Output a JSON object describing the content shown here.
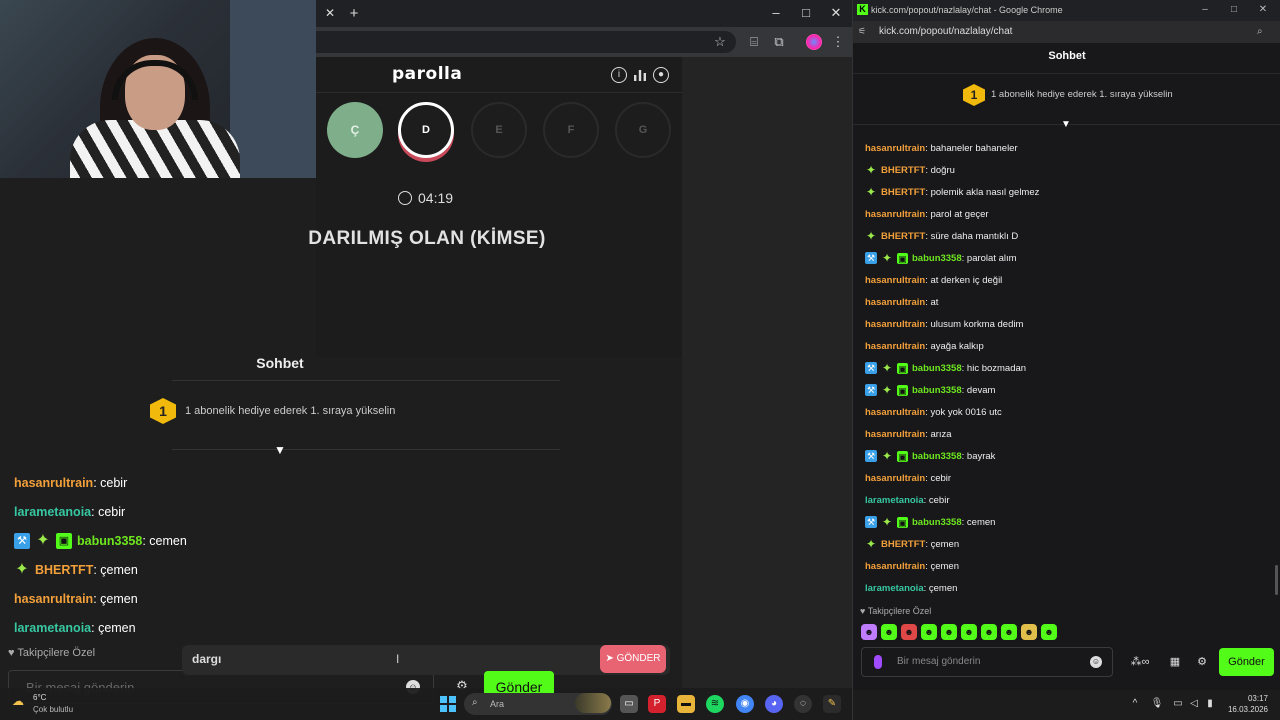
{
  "browser": {
    "window_controls": {
      "minimize": "–",
      "maximize": "□",
      "close": "✕"
    },
    "tab_close": "✕",
    "new_tab": "+"
  },
  "game": {
    "title": "parolla",
    "letters": [
      {
        "char": "Ç",
        "state": "done"
      },
      {
        "char": "D",
        "state": "active"
      },
      {
        "char": "E",
        "state": "idle"
      },
      {
        "char": "F",
        "state": "idle"
      },
      {
        "char": "G",
        "state": "idle"
      }
    ],
    "timer": "04:19",
    "clue": "DARILMIŞ OLAN (KİMSE)",
    "input_value": "dargı",
    "send_label": "GÖNDER"
  },
  "overlay_chat": {
    "title": "Sohbet",
    "gift_badge": "1",
    "gift_text": "1 abonelik hediye ederek 1. sıraya yükselin",
    "messages": [
      {
        "user": "hasanrultrain",
        "color": "#f2a03a",
        "text": ": cebir",
        "badges": []
      },
      {
        "user": "larametanoia",
        "color": "#37c7a1",
        "text": ": cebir",
        "badges": []
      },
      {
        "user": "babun3358",
        "color": "#6ee61f",
        "text": ": cemen",
        "badges": [
          "blue",
          "star",
          "gift"
        ]
      },
      {
        "user": "BHERTFT",
        "color": "#f2a03a",
        "text": ": çemen",
        "badges": [
          "star"
        ]
      },
      {
        "user": "hasanrultrain",
        "color": "#f2a03a",
        "text": ": çemen",
        "badges": []
      },
      {
        "user": "larametanoia",
        "color": "#37c7a1",
        "text": ": çemen",
        "badges": []
      }
    ],
    "follower_only": "Takipçilere Özel",
    "input_placeholder": "Bir mesaj gönderin",
    "send_label": "Gönder"
  },
  "taskbar": {
    "weather_temp": "6°C",
    "weather_desc": "Çok bulutlu",
    "search_label": "Ara",
    "time": "03:17",
    "date": "16.03.2026"
  },
  "popout": {
    "window_title": "kick.com/popout/nazlalay/chat - Google Chrome",
    "url": "kick.com/popout/nazlalay/chat",
    "chat_title": "Sohbet",
    "gift_badge": "1",
    "gift_text": "1 abonelik hediye ederek 1. sıraya yükselin",
    "messages": [
      {
        "user": "hasanrultrain",
        "color": "#f2a03a",
        "text": ": bahaneler bahaneler",
        "badges": []
      },
      {
        "user": "BHERTFT",
        "color": "#f2a03a",
        "text": ": doğru",
        "badges": [
          "star"
        ]
      },
      {
        "user": "BHERTFT",
        "color": "#f2a03a",
        "text": ": polemik akla nasıl gelmez",
        "badges": [
          "star"
        ]
      },
      {
        "user": "hasanrultrain",
        "color": "#f2a03a",
        "text": ": parol at geçer",
        "badges": []
      },
      {
        "user": "BHERTFT",
        "color": "#f2a03a",
        "text": ": süre daha mantıklı D",
        "badges": [
          "star"
        ]
      },
      {
        "user": "babun3358",
        "color": "#6ee61f",
        "text": ": parolat alım",
        "badges": [
          "blue",
          "star",
          "gift"
        ]
      },
      {
        "user": "hasanrultrain",
        "color": "#f2a03a",
        "text": ": at derken iç değil",
        "badges": []
      },
      {
        "user": "hasanrultrain",
        "color": "#f2a03a",
        "text": ": at",
        "badges": []
      },
      {
        "user": "hasanrultrain",
        "color": "#f2a03a",
        "text": ": ulusum korkma dedim",
        "badges": []
      },
      {
        "user": "hasanrultrain",
        "color": "#f2a03a",
        "text": ": ayağa kalkıp",
        "badges": []
      },
      {
        "user": "babun3358",
        "color": "#6ee61f",
        "text": ": hic bozmadan",
        "badges": [
          "blue",
          "star",
          "gift"
        ]
      },
      {
        "user": "babun3358",
        "color": "#6ee61f",
        "text": ": devam",
        "badges": [
          "blue",
          "star",
          "gift"
        ]
      },
      {
        "user": "hasanrultrain",
        "color": "#f2a03a",
        "text": ": yok yok 0016 utc",
        "badges": []
      },
      {
        "user": "hasanrultrain",
        "color": "#f2a03a",
        "text": ": arıza",
        "badges": []
      },
      {
        "user": "babun3358",
        "color": "#6ee61f",
        "text": ": bayrak",
        "badges": [
          "blue",
          "star",
          "gift"
        ]
      },
      {
        "user": "hasanrultrain",
        "color": "#f2a03a",
        "text": ": cebir",
        "badges": []
      },
      {
        "user": "larametanoia",
        "color": "#37c7a1",
        "text": ": cebir",
        "badges": []
      },
      {
        "user": "babun3358",
        "color": "#6ee61f",
        "text": ": cemen",
        "badges": [
          "blue",
          "star",
          "gift"
        ]
      },
      {
        "user": "BHERTFT",
        "color": "#f2a03a",
        "text": ": çemen",
        "badges": [
          "star"
        ]
      },
      {
        "user": "hasanrultrain",
        "color": "#f2a03a",
        "text": ": çemen",
        "badges": []
      },
      {
        "user": "larametanoia",
        "color": "#37c7a1",
        "text": ": çemen",
        "badges": []
      }
    ],
    "follower_only": "Takipçilere Özel",
    "emote_colors": [
      "#c07cff",
      "#53fc18",
      "#e04848",
      "#53fc18",
      "#53fc18",
      "#53fc18",
      "#53fc18",
      "#53fc18",
      "#e0c04a",
      "#53fc18"
    ],
    "input_placeholder": "Bir mesaj gönderin",
    "send_label": "Gönder"
  },
  "colors": {
    "kick_green": "#53fc18",
    "game_send": "#e86473",
    "letter_done": "#7fae8a",
    "badge_gold": "#f0b90b"
  }
}
